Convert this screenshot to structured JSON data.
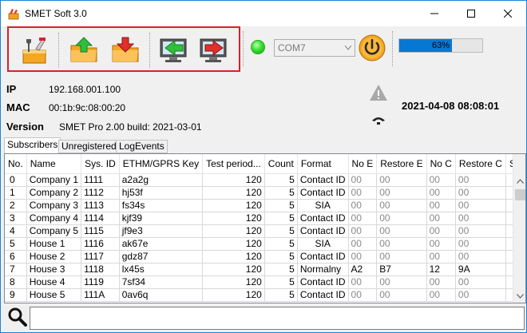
{
  "window": {
    "title": "SMET Soft 3.0"
  },
  "toolbar": {
    "com_port": "COM7",
    "progress_percent": 63,
    "progress_label": "63%",
    "led_color": "#37e02f",
    "accent": "#d9202a"
  },
  "info": {
    "ip_label": "IP",
    "ip_value": "192.168.001.100",
    "mac_label": "MAC",
    "mac_value": "00:1b:9c:08:00:20",
    "version_label": "Version",
    "version_value": "SMET Pro 2.00 build: 2021-03-01",
    "datetime": "2021-04-08 08:08:01"
  },
  "tabs": [
    {
      "label": "Subscribers"
    },
    {
      "label": "Unregistered"
    },
    {
      "label": "LogEvents"
    }
  ],
  "grid": {
    "columns": [
      "No.",
      "Name",
      "Sys. ID",
      "ETHM/GPRS Key",
      "Test period...",
      "Count",
      "Format",
      "No E",
      "Restore E",
      "No C",
      "Restore C",
      "Status"
    ],
    "rows": [
      [
        "0",
        "Company 1",
        "1111",
        "a2a2g",
        "120",
        "5",
        "Contact ID",
        "00",
        "00",
        "00",
        "00"
      ],
      [
        "1",
        "Company 2",
        "1112",
        "hj53f",
        "120",
        "5",
        "Contact ID",
        "00",
        "00",
        "00",
        "00"
      ],
      [
        "2",
        "Company 3",
        "1113",
        "fs34s",
        "120",
        "5",
        "SIA",
        "00",
        "00",
        "00",
        "00"
      ],
      [
        "3",
        "Company 4",
        "1114",
        "kjf39",
        "120",
        "5",
        "Contact ID",
        "00",
        "00",
        "00",
        "00"
      ],
      [
        "4",
        "Company 5",
        "1115",
        "jf9e3",
        "120",
        "5",
        "Contact ID",
        "00",
        "00",
        "00",
        "00"
      ],
      [
        "5",
        "House 1",
        "1116",
        "ak67e",
        "120",
        "5",
        "SIA",
        "00",
        "00",
        "00",
        "00"
      ],
      [
        "6",
        "House 2",
        "1117",
        "gdz87",
        "120",
        "5",
        "Contact ID",
        "00",
        "00",
        "00",
        "00"
      ],
      [
        "7",
        "House 3",
        "1118",
        "lx45s",
        "120",
        "5",
        "Normalny",
        "A2",
        "B7",
        "12",
        "9A"
      ],
      [
        "8",
        "House 4",
        "1119",
        "7sf34",
        "120",
        "5",
        "Contact ID",
        "00",
        "00",
        "00",
        "00"
      ],
      [
        "9",
        "House 5",
        "111A",
        "0av6q",
        "120",
        "5",
        "Contact ID",
        "00",
        "00",
        "00",
        "00"
      ]
    ],
    "status_icon": "check-icon"
  },
  "search": {
    "value": ""
  }
}
